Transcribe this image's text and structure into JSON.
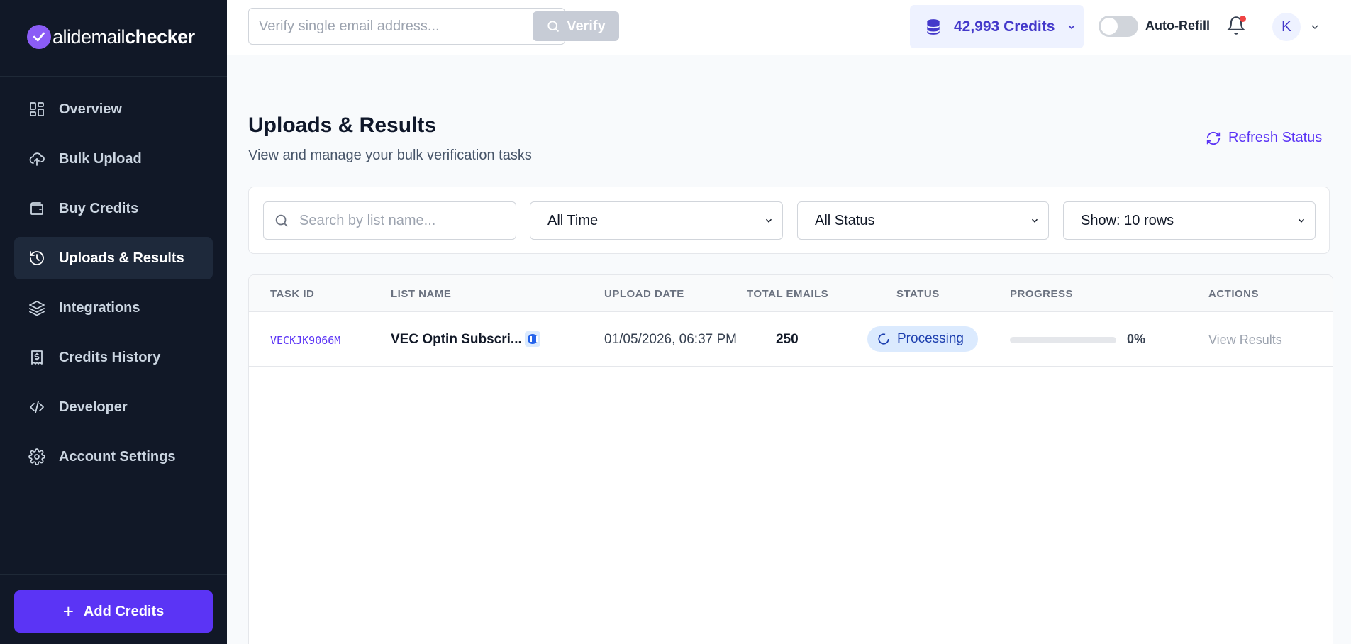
{
  "brand": {
    "logo_letter": "v",
    "logo_light": "alidemail",
    "logo_bold": "checker",
    "accent": "#5b34f5"
  },
  "sidebar": {
    "items": [
      {
        "label": "Overview",
        "icon": "grid-icon",
        "active": false
      },
      {
        "label": "Bulk Upload",
        "icon": "cloud-upload-icon",
        "active": false
      },
      {
        "label": "Buy Credits",
        "icon": "wallet-icon",
        "active": false
      },
      {
        "label": "Uploads & Results",
        "icon": "history-icon",
        "active": true
      },
      {
        "label": "Integrations",
        "icon": "layers-icon",
        "active": false
      },
      {
        "label": "Credits History",
        "icon": "receipt-icon",
        "active": false
      },
      {
        "label": "Developer",
        "icon": "code-icon",
        "active": false
      },
      {
        "label": "Account Settings",
        "icon": "gear-icon",
        "active": false
      }
    ],
    "add_credits": "Add Credits"
  },
  "topbar": {
    "verify_placeholder": "Verify single email address...",
    "verify_label": "Verify",
    "credits": "42,993 Credits",
    "auto_refill": "Auto-Refill",
    "auto_refill_on": false,
    "avatar_initial": "K"
  },
  "main": {
    "title": "Uploads & Results",
    "subtitle": "View and manage your bulk verification tasks",
    "refresh_label": "Refresh Status",
    "filters": {
      "search_placeholder": "Search by list name...",
      "time": "All Time",
      "status": "All Status",
      "rows": "Show: 10 rows"
    },
    "table": {
      "headers": [
        "TASK ID",
        "LIST NAME",
        "UPLOAD DATE",
        "TOTAL EMAILS",
        "STATUS",
        "PROGRESS",
        "ACTIONS"
      ],
      "rows": [
        {
          "task_id": "VECKJK9066M",
          "list_name": "VEC Optin Subscri...",
          "upload_date": "01/05/2026, 06:37 PM",
          "total_emails": "250",
          "status": "Processing",
          "progress_value": 0,
          "progress": "0%",
          "action": "View Results"
        }
      ]
    }
  }
}
